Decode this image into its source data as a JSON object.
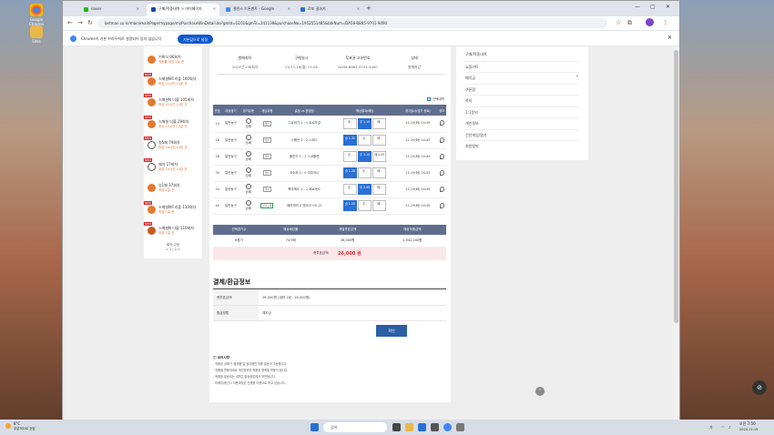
{
  "desktop": {
    "icons": [
      {
        "label": "Google Chrome"
      },
      {
        "label": "Sites"
      }
    ]
  },
  "browser": {
    "tabs": [
      {
        "label": "naver"
      },
      {
        "label": "구매/적중내역 > 마이페이지"
      },
      {
        "label": "젤린스 드론벤트 - Google"
      },
      {
        "label": "로또 결과기"
      }
    ],
    "new_tab": "+",
    "url": "betman.co.kr/main/mainPage/mypage/myPurchaseWinDetail.do?gmId=G101&gmTs=241138&purchaseNo=1952551485&btkNum=DA58-B865-9701-9490",
    "infobar_text": "Chrome이 기본 브라우저로 설정되어 있지 않습니다",
    "infobar_button": "기본값으로 설정",
    "controls": {
      "min": "—",
      "max": "▢",
      "close": "✕"
    }
  },
  "left_panel": {
    "items": [
      {
        "title": "기록식 96회차",
        "sub": "적중률 마감 2일 전",
        "ball": "orange",
        "new": ""
      },
      {
        "title": "스페셜N트리플 100회차",
        "sub": "마감 21시간 13분 전",
        "ball": "orange",
        "new": "NEW"
      },
      {
        "title": "스페셜N 더블 105회차",
        "sub": "마감 21시간 13분 전",
        "ball": "orange",
        "new": "NEW"
      },
      {
        "title": "스페셜 더블 29회차",
        "sub": "마감 11시간 13분 전",
        "ball": "orange",
        "new": "NEW"
      },
      {
        "title": "승5패 79회차",
        "sub": "마감 14시간 13분 전",
        "ball": "white",
        "new": "NEW"
      },
      {
        "title": "매치 17회차",
        "sub": "마감 14시간 13분 전",
        "ball": "white",
        "new": "NEW"
      },
      {
        "title": "승1패 37회차",
        "sub": "마감 1일 전",
        "ball": "orange",
        "new": ""
      },
      {
        "title": "스페셜N트리플 110회차",
        "sub": "마감 1일 전",
        "ball": "orange",
        "new": "NEW"
      },
      {
        "title": "스페셜N 더블 110회차",
        "sub": "마감 1일 전",
        "ball": "brown",
        "new": "NEW"
      }
    ],
    "footer_label": "회차 고정",
    "pager": "< 1 / 2 >"
  },
  "summary": {
    "cols": [
      {
        "label": "발매회차",
        "value": "2024년 138회차"
      },
      {
        "label": "구매일시",
        "value": "24.11.18(월) 15:58"
      },
      {
        "label": "투표권 고유번호",
        "value": "DA58-B865-9701-9490"
      },
      {
        "label": "상태",
        "value": "발매마감"
      }
    ]
  },
  "bets": {
    "check_label": "선택내역",
    "headers": [
      "번호",
      "대상경기",
      "경기유형",
      "게임유형",
      "홈팀 vs 원정팀",
      "예상결과/배당",
      "경기일시(경기 종료)",
      "정보"
    ],
    "rows": [
      {
        "no": "14",
        "sport": "일반농구",
        "game_type": "승패",
        "team_label": "일반",
        "match": "그르바가 1 : 1 트르투갈",
        "o1": "승 -",
        "o2": "무 1.15",
        "o3": "패 -",
        "time": "11.19(화) 04:45",
        "sel": 2
      },
      {
        "no": "16",
        "sport": "일반농구",
        "game_type": "승패",
        "team_label": "일반",
        "match": "스웨던 3 : 2 스위스",
        "o1": "승 1.32",
        "o2": "무 -",
        "o3": "패 -",
        "time": "11.19(화) 04:45",
        "sel": 1
      },
      {
        "no": "26",
        "sport": "일반농구",
        "game_type": "승패",
        "team_label": "일반",
        "match": "폴란드 1 : 2 스코틀랜",
        "o1": "승 -",
        "o2": "무 3.10",
        "o3": "패 2.05",
        "time": "11.19(화) 04:45",
        "sel": 2
      },
      {
        "no": "30",
        "sport": "일반농구",
        "game_type": "승패",
        "team_label": "일반",
        "match": "코소보 1 : 0 리투아니",
        "o1": "승 1.28",
        "o2": "무 -",
        "o3": "패 -",
        "time": "11.19(화) 04:45",
        "sel": 1
      },
      {
        "no": "34",
        "sport": "일반농구",
        "game_type": "승패",
        "team_label": "일반",
        "match": "북마케도 2 : 2 페로제도",
        "o1": "승 -",
        "o2": "무 2.95",
        "o3": "패 -",
        "time": "11.19(화) 04:45",
        "sel": 2
      },
      {
        "no": "40",
        "sport": "일반농구",
        "game_type": "승패",
        "team_label": "언더오버",
        "match": "페라케라 0 덴마크 U0.13",
        "o1": "승 1.55",
        "o2": "무 -",
        "o3": "패 -",
        "time": "11.19(화) 04:45",
        "sel": 1
      }
    ]
  },
  "totals": {
    "headers": [
      "선택경기수",
      "예상배당률",
      "개별투표금액",
      "예상적중금액"
    ],
    "values": [
      "6경기",
      "74.7배",
      "26,000원",
      "1,942,200원"
    ],
    "total_label": "총투표금액",
    "total_value": "26,000 원"
  },
  "payment": {
    "title": "결제/환급정보",
    "rows": [
      {
        "label": "총투표금액",
        "value": "26,000원 (계좌 1회 : 26,000원)"
      },
      {
        "label": "환급방법",
        "value": "예치금"
      }
    ],
    "ok_button": "확인"
  },
  "notes": {
    "title": "유의사항",
    "lines": [
      "- 적중된 상태가 '발매중'일 경우에만 적중 발송이 가능합니다.",
      "- 적중을 활동하세요 개인정보와 적중된 항목을 활동이 됩니다.",
      "- 적중을 발송되는 내역은 발송등본에서 보관됩니다.",
      "- 미배치/중간시 이용과정은 인증을 이용으로 하고 있습니다."
    ]
  },
  "right_menu": {
    "items": [
      {
        "label": "구매/적중내역",
        "chev": ""
      },
      {
        "label": "쇼핑카트",
        "chev": ""
      },
      {
        "label": "예치금",
        "chev": "⌄"
      },
      {
        "label": "쿠폰함",
        "chev": ""
      },
      {
        "label": "쪽지",
        "chev": ""
      },
      {
        "label": "1:1문의",
        "chev": ""
      },
      {
        "label": "개인정보",
        "chev": ""
      },
      {
        "label": "건전게임/알기",
        "chev": ""
      },
      {
        "label": "회원탈퇴",
        "chev": ""
      }
    ]
  },
  "taskbar": {
    "weather_temp": "8°C",
    "weather_text": "부분적으로 흐림",
    "search_placeholder": "검색",
    "time": "오전 7:50",
    "date": "2024-11-19",
    "lang": "가"
  }
}
